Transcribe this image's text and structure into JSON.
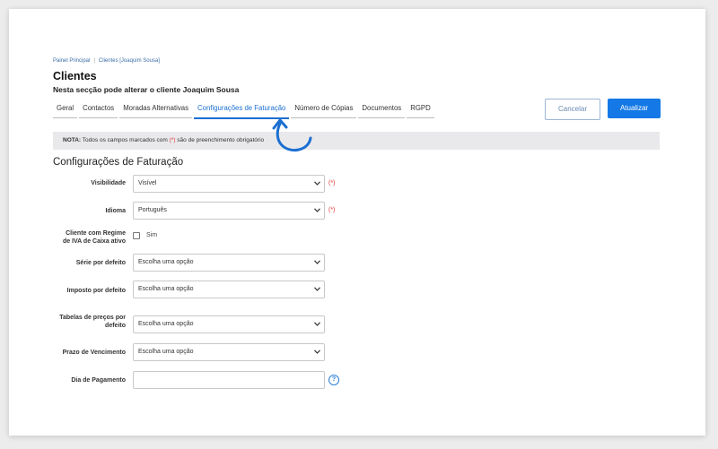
{
  "breadcrumb": {
    "home": "Painel Principal",
    "current": "Clientes [Joaquim Sousa]"
  },
  "header": {
    "title": "Clientes",
    "subtitle_prefix": "Nesta secção pode alterar o cliente ",
    "client_name": "Joaquim Sousa"
  },
  "tabs": [
    {
      "label": "Geral",
      "active": false
    },
    {
      "label": "Contactos",
      "active": false
    },
    {
      "label": "Moradas Alternativas",
      "active": false
    },
    {
      "label": "Configurações de Faturação",
      "active": true
    },
    {
      "label": "Número de Cópias",
      "active": false
    },
    {
      "label": "Documentos",
      "active": false
    },
    {
      "label": "RGPD",
      "active": false
    }
  ],
  "actions": {
    "cancel_label": "Cancelar",
    "update_label": "Atualizar"
  },
  "note": {
    "bold": "NOTA:",
    "text_before": " Todos os campos marcados com ",
    "required_marker": "(*)",
    "text_after": " são de preenchimento obrigatório"
  },
  "section": {
    "title": "Configurações de Faturação"
  },
  "form": {
    "visibility": {
      "label": "Visibilidade",
      "value": "Visível",
      "required_marker": "(*)"
    },
    "language": {
      "label": "Idioma",
      "value": "Português",
      "required_marker": "(*)"
    },
    "vat_cash": {
      "label_line1": "Cliente com Regime",
      "label_line2": "de IVA de Caixa ativo",
      "option": "Sim",
      "checked": false
    },
    "series": {
      "label": "Série por defeito",
      "value": "Escolha uma opção"
    },
    "tax": {
      "label": "Imposto por defeito",
      "value": "Escolha uma opção"
    },
    "price_tables": {
      "label_line1": "Tabelas de preços por",
      "label_line2": "defeito",
      "value": "Escolha uma opção"
    },
    "due_term": {
      "label": "Prazo de Vencimento",
      "value": "Escolha uma opção"
    },
    "payment_day": {
      "label": "Dia de Pagamento",
      "value": "",
      "help_symbol": "?"
    }
  },
  "colors": {
    "accent": "#1479e6",
    "required": "#d33333",
    "note_bg": "#e9e9ec"
  },
  "icons": {
    "select": "chevron-down-icon",
    "help": "help-circle-icon",
    "annotation": "curved-arrow-icon"
  }
}
